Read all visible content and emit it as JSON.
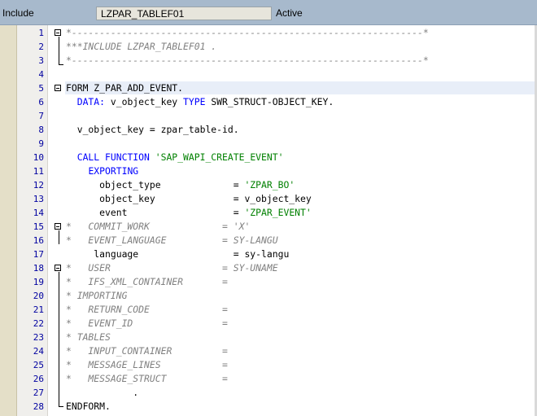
{
  "header": {
    "type_label": "Include",
    "object_name": "LZPAR_TABLEF01",
    "status": "Active"
  },
  "lines": [
    {
      "num": "1",
      "fold": true,
      "parts": [
        {
          "c": "cmt",
          "t": "*---------------------------------------------------------------*"
        }
      ]
    },
    {
      "num": "2",
      "fold": false,
      "parts": [
        {
          "c": "cmt",
          "t": "***INCLUDE LZPAR_TABLEF01 ."
        }
      ]
    },
    {
      "num": "3",
      "fold": false,
      "parts": [
        {
          "c": "cmt",
          "t": "*---------------------------------------------------------------*"
        }
      ]
    },
    {
      "num": "4",
      "fold": false,
      "parts": []
    },
    {
      "num": "5",
      "fold": true,
      "parts": [
        {
          "c": "",
          "t": "FORM Z_PAR_ADD_EVENT."
        }
      ]
    },
    {
      "num": "6",
      "fold": false,
      "parts": [
        {
          "c": "",
          "t": "  "
        },
        {
          "c": "kw",
          "t": "DATA:"
        },
        {
          "c": "",
          "t": " v_object_key "
        },
        {
          "c": "kw",
          "t": "TYPE"
        },
        {
          "c": "",
          "t": " SWR_STRUCT-OBJECT_KEY."
        }
      ]
    },
    {
      "num": "7",
      "fold": false,
      "parts": []
    },
    {
      "num": "8",
      "fold": false,
      "parts": [
        {
          "c": "",
          "t": "  v_object_key = zpar_table-id."
        }
      ]
    },
    {
      "num": "9",
      "fold": false,
      "parts": []
    },
    {
      "num": "10",
      "fold": false,
      "parts": [
        {
          "c": "",
          "t": "  "
        },
        {
          "c": "kw",
          "t": "CALL FUNCTION"
        },
        {
          "c": "",
          "t": " "
        },
        {
          "c": "str",
          "t": "'SAP_WAPI_CREATE_EVENT'"
        }
      ]
    },
    {
      "num": "11",
      "fold": false,
      "parts": [
        {
          "c": "",
          "t": "    "
        },
        {
          "c": "kw",
          "t": "EXPORTING"
        }
      ]
    },
    {
      "num": "12",
      "fold": false,
      "parts": [
        {
          "c": "",
          "t": "      object_type             = "
        },
        {
          "c": "str",
          "t": "'ZPAR_BO'"
        }
      ]
    },
    {
      "num": "13",
      "fold": false,
      "parts": [
        {
          "c": "",
          "t": "      object_key              = v_object_key"
        }
      ]
    },
    {
      "num": "14",
      "fold": false,
      "parts": [
        {
          "c": "",
          "t": "      event                   = "
        },
        {
          "c": "str",
          "t": "'ZPAR_EVENT'"
        }
      ]
    },
    {
      "num": "15",
      "fold": true,
      "parts": [
        {
          "c": "cmt",
          "t": "*   COMMIT_WORK             = 'X'"
        }
      ]
    },
    {
      "num": "16",
      "fold": false,
      "parts": [
        {
          "c": "cmt",
          "t": "*   EVENT_LANGUAGE          = SY-LANGU"
        }
      ]
    },
    {
      "num": "17",
      "fold": false,
      "parts": [
        {
          "c": "",
          "t": "     language                 = sy-langu"
        }
      ]
    },
    {
      "num": "18",
      "fold": true,
      "parts": [
        {
          "c": "cmt",
          "t": "*   USER                    = SY-UNAME"
        }
      ]
    },
    {
      "num": "19",
      "fold": false,
      "parts": [
        {
          "c": "cmt",
          "t": "*   IFS_XML_CONTAINER       ="
        }
      ]
    },
    {
      "num": "20",
      "fold": false,
      "parts": [
        {
          "c": "cmt",
          "t": "* IMPORTING"
        }
      ]
    },
    {
      "num": "21",
      "fold": false,
      "parts": [
        {
          "c": "cmt",
          "t": "*   RETURN_CODE             ="
        }
      ]
    },
    {
      "num": "22",
      "fold": false,
      "parts": [
        {
          "c": "cmt",
          "t": "*   EVENT_ID                ="
        }
      ]
    },
    {
      "num": "23",
      "fold": false,
      "parts": [
        {
          "c": "cmt",
          "t": "* TABLES"
        }
      ]
    },
    {
      "num": "24",
      "fold": false,
      "parts": [
        {
          "c": "cmt",
          "t": "*   INPUT_CONTAINER         ="
        }
      ]
    },
    {
      "num": "25",
      "fold": false,
      "parts": [
        {
          "c": "cmt",
          "t": "*   MESSAGE_LINES           ="
        }
      ]
    },
    {
      "num": "26",
      "fold": false,
      "parts": [
        {
          "c": "cmt",
          "t": "*   MESSAGE_STRUCT          ="
        }
      ]
    },
    {
      "num": "27",
      "fold": false,
      "parts": [
        {
          "c": "",
          "t": "            ."
        }
      ]
    },
    {
      "num": "28",
      "fold": false,
      "parts": [
        {
          "c": "",
          "t": "ENDFORM."
        }
      ]
    }
  ],
  "colors": {
    "keyword": "#0000ff",
    "string": "#008000",
    "comment": "#808080",
    "line_number": "#0000a0",
    "header_bg": "#a7b9cc"
  }
}
